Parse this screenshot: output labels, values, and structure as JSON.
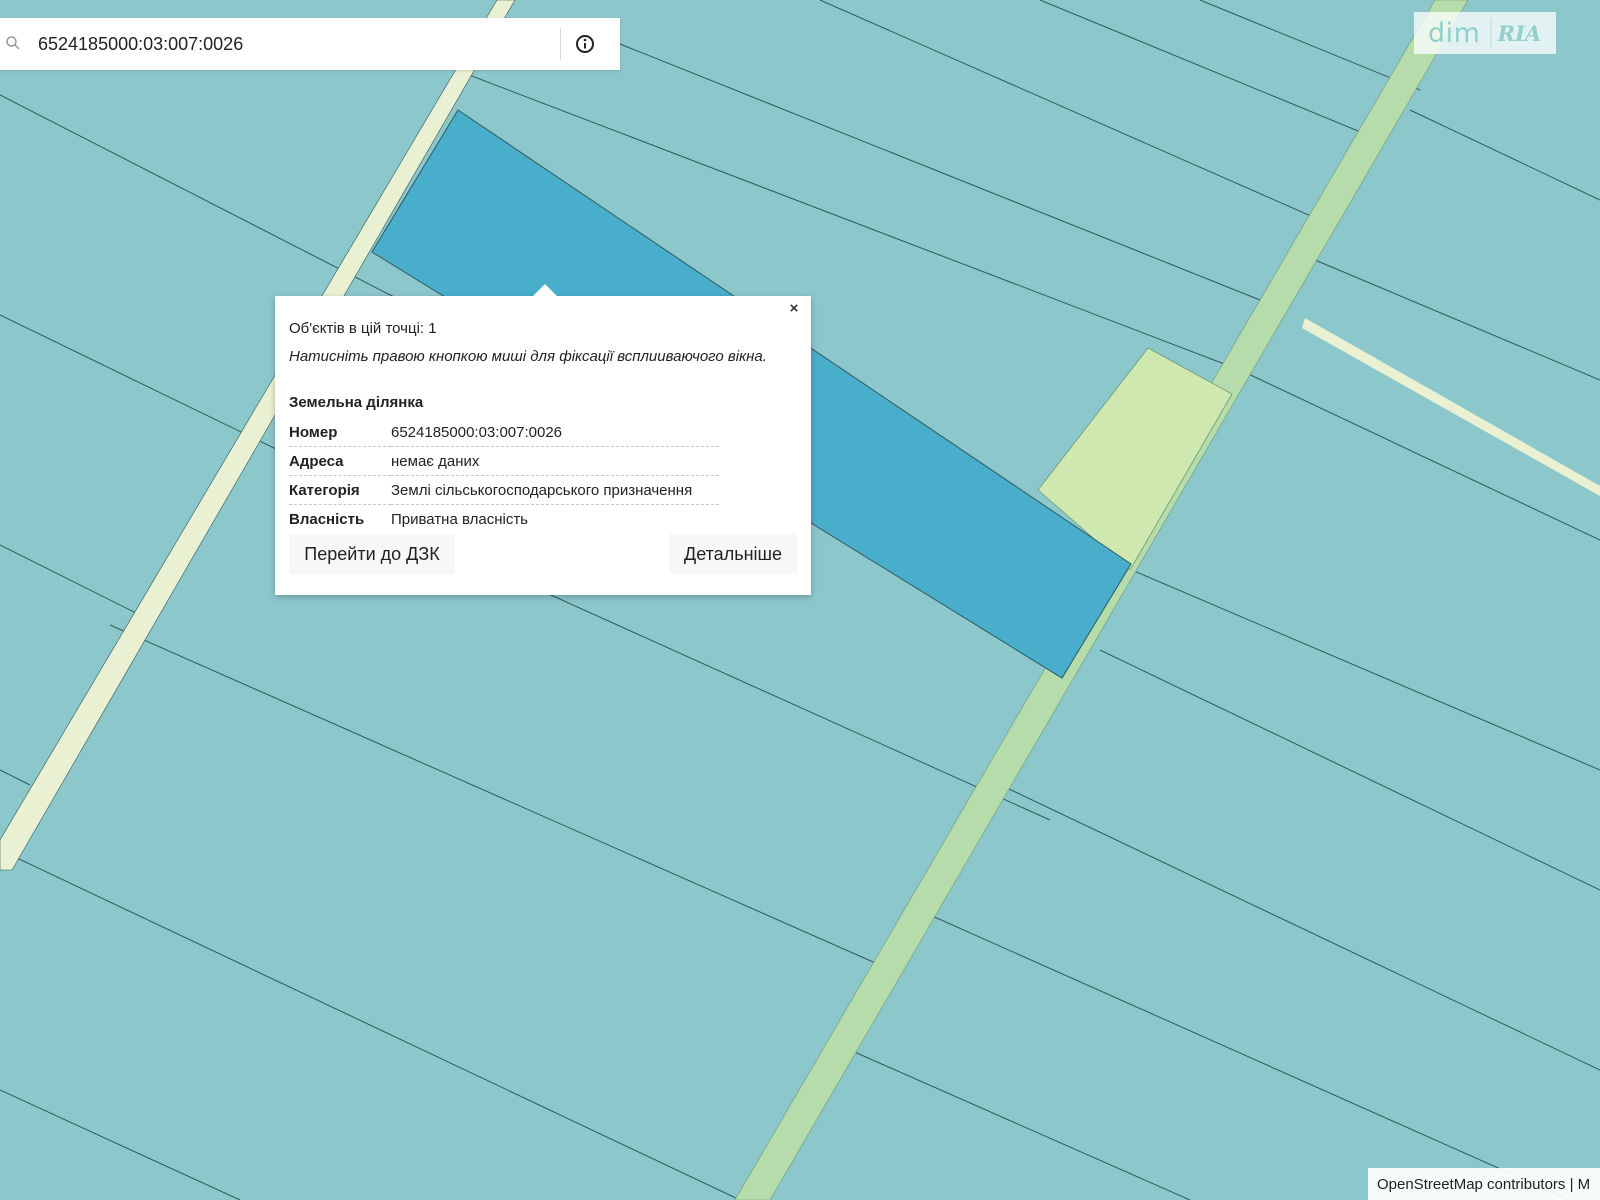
{
  "search": {
    "value": "6524185000:03:007:0026"
  },
  "logo": {
    "dim": "dim",
    "ria": "RIA"
  },
  "popup": {
    "close_label": "×",
    "objects_count": "Об'єктів в цій точці: 1",
    "hint": "Натисніть правою кнопкою миші для фіксації всплиuваючого вікна.",
    "section_title": "Земельна ділянка",
    "rows": [
      {
        "key": "Номер",
        "value": "6524185000:03:007:0026"
      },
      {
        "key": "Адреса",
        "value": "немає даних"
      },
      {
        "key": "Категорія",
        "value": "Землі сільськогосподарського призначення"
      },
      {
        "key": "Власність",
        "value": "Приватна власність"
      }
    ],
    "button_dzk": "Перейти до ДЗК",
    "button_details": "Детальніше"
  },
  "attribution": "OpenStreetMap contributors | M",
  "colors": {
    "background_parcel": "#8cc7cc",
    "selected_parcel": "#48aecb",
    "road": "#eaf1d2",
    "green_strip": "#b5dcaa",
    "green_plot": "#cfe8b0",
    "boundary": "#2e5a5e"
  }
}
